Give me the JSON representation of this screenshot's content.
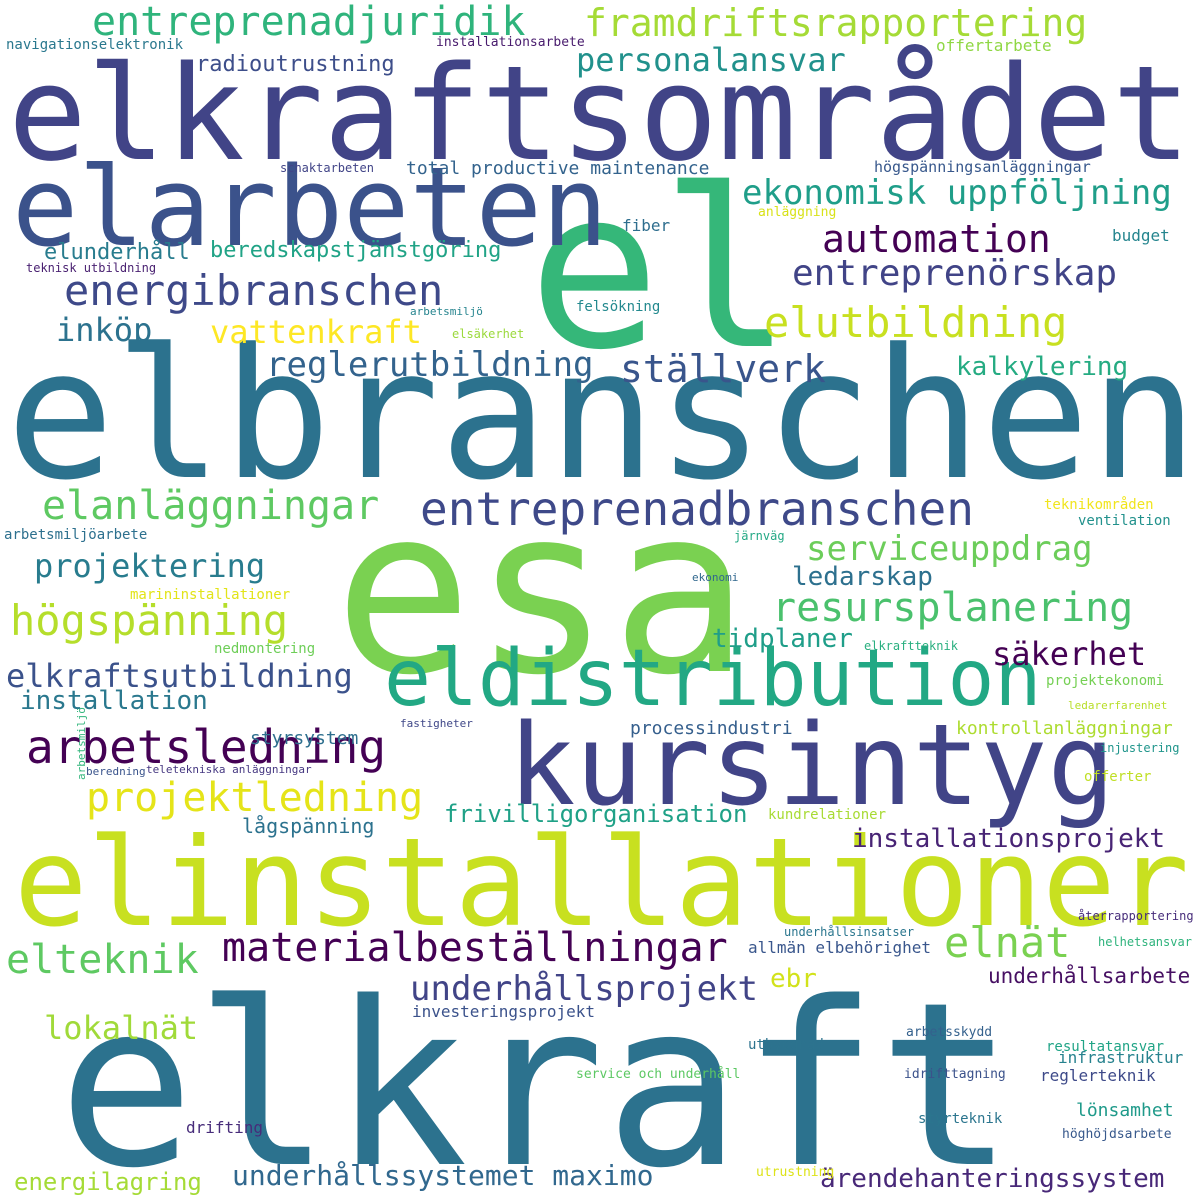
{
  "palette": [
    "#440154",
    "#46327e",
    "#365c8d",
    "#277f8e",
    "#1fa187",
    "#4ac16d",
    "#a0da39",
    "#fde725"
  ],
  "words": [
    {
      "id": "elkraft",
      "text": "elkraft",
      "color": "#2c728e"
    },
    {
      "id": "elbranschen",
      "text": "elbranschen",
      "color": "#2c728e"
    },
    {
      "id": "esa",
      "text": "esa",
      "color": "#7ad151"
    },
    {
      "id": "elkraftsomradet",
      "text": "elkraftsområdet",
      "color": "#414487"
    },
    {
      "id": "el",
      "text": "el",
      "color": "#35b779"
    },
    {
      "id": "elinstallationer",
      "text": "elinstallationer",
      "color": "#c8e020"
    },
    {
      "id": "elarbeten",
      "text": "elarbeten",
      "color": "#3b528b"
    },
    {
      "id": "kursintyg",
      "text": "kursintyg",
      "color": "#414487"
    },
    {
      "id": "eldistribution",
      "text": "eldistribution",
      "color": "#22a884"
    },
    {
      "id": "entreprenadjuridik",
      "text": "entreprenadjuridik",
      "color": "#2fb47c"
    },
    {
      "id": "framdriftsrapportering",
      "text": "framdriftsrapportering",
      "color": "#a5db36"
    },
    {
      "id": "entreprenadbranschen",
      "text": "entreprenadbranschen",
      "color": "#3e4989"
    },
    {
      "id": "arbetsledning",
      "text": "arbetsledning",
      "color": "#440154"
    },
    {
      "id": "materialbestallningar",
      "text": "materialbeställningar",
      "color": "#440154"
    },
    {
      "id": "energibranschen",
      "text": "energibranschen",
      "color": "#3e4989"
    },
    {
      "id": "elanlaggningar",
      "text": "elanläggningar",
      "color": "#5ec962"
    },
    {
      "id": "resursplanering",
      "text": "resursplanering",
      "color": "#4ac16d"
    },
    {
      "id": "hogspanning",
      "text": "högspänning",
      "color": "#b5de2b"
    },
    {
      "id": "elutbildning",
      "text": "elutbildning",
      "color": "#c8e020"
    },
    {
      "id": "projektledning",
      "text": "projektledning",
      "color": "#e5e419"
    },
    {
      "id": "entreprenorskap",
      "text": "entreprenörskap",
      "color": "#414487"
    },
    {
      "id": "automation",
      "text": "automation",
      "color": "#440154"
    },
    {
      "id": "ekonomisk-uppfoljning",
      "text": "ekonomisk uppföljning",
      "color": "#1f9e89"
    },
    {
      "id": "serviceuppdrag",
      "text": "serviceuppdrag",
      "color": "#6ccd5a"
    },
    {
      "id": "reglerutbildning",
      "text": "reglerutbildning",
      "color": "#33638d"
    },
    {
      "id": "stallverk",
      "text": "ställverk",
      "color": "#39558c"
    },
    {
      "id": "elkraftsutbildning",
      "text": "elkraftsutbildning",
      "color": "#3b528b"
    },
    {
      "id": "underhallsprojekt",
      "text": "underhållsprojekt",
      "color": "#414487"
    },
    {
      "id": "underhallssystemet-maximo",
      "text": "underhållssystemet maximo",
      "color": "#31688e"
    },
    {
      "id": "elnat",
      "text": "elnät",
      "color": "#7ad151"
    },
    {
      "id": "elteknik",
      "text": "elteknik",
      "color": "#5ec962"
    },
    {
      "id": "personalansvar",
      "text": "personalansvar",
      "color": "#21918c"
    },
    {
      "id": "projektering",
      "text": "projektering",
      "color": "#287c8e"
    },
    {
      "id": "vattenkraft",
      "text": "vattenkraft",
      "color": "#fde725"
    },
    {
      "id": "installationsprojekt",
      "text": "installationsprojekt",
      "color": "#482475"
    },
    {
      "id": "arendehanteringssystem",
      "text": "ärendehanteringssystem",
      "color": "#482878"
    },
    {
      "id": "lokalnat",
      "text": "lokalnät",
      "color": "#a0da39"
    },
    {
      "id": "inkop",
      "text": "inköp",
      "color": "#2c728e"
    },
    {
      "id": "sakerhet",
      "text": "säkerhet",
      "color": "#440154"
    },
    {
      "id": "underhallsarbete",
      "text": "underhållsarbete",
      "color": "#471063"
    },
    {
      "id": "frivilligorganisation",
      "text": "frivilligorganisation",
      "color": "#1fa187"
    },
    {
      "id": "installation",
      "text": "installation",
      "color": "#2a788e"
    },
    {
      "id": "ledarskap",
      "text": "ledarskap",
      "color": "#2d708e"
    },
    {
      "id": "kalkylering",
      "text": "kalkylering",
      "color": "#25ab82"
    },
    {
      "id": "tidplaner",
      "text": "tidplaner",
      "color": "#1f9e89"
    },
    {
      "id": "beredskapstjanstgoring",
      "text": "beredskapstjänstgöring",
      "color": "#20a386"
    },
    {
      "id": "elunderhall",
      "text": "elunderhåll",
      "color": "#287c8e"
    },
    {
      "id": "radioutrustning",
      "text": "radioutrustning",
      "color": "#3d4e8a"
    },
    {
      "id": "energilagring",
      "text": "energilagring",
      "color": "#a5db36"
    },
    {
      "id": "lonsamhet",
      "text": "lönsamhet",
      "color": "#1f9a8a"
    },
    {
      "id": "ebr",
      "text": "ebr",
      "color": "#d2e21b"
    },
    {
      "id": "styrsystem",
      "text": "styrsystem",
      "color": "#2e6f8e"
    },
    {
      "id": "lagspanning",
      "text": "lågspänning",
      "color": "#2c728e"
    },
    {
      "id": "total-productive-maintenance",
      "text": "total productive maintenance",
      "color": "#33638d"
    },
    {
      "id": "processindustri",
      "text": "processindustri",
      "color": "#355f8d"
    },
    {
      "id": "kontrollanlaggningar",
      "text": "kontrollanläggningar",
      "color": "#addc30"
    },
    {
      "id": "navigationselektronik",
      "text": "navigationselektronik",
      "color": "#2a788e"
    },
    {
      "id": "installationsarbete",
      "text": "installationsarbete",
      "color": "#481b6d"
    },
    {
      "id": "offertarbete",
      "text": "offertarbete",
      "color": "#8fd744"
    },
    {
      "id": "hogspanningsanlaggningar",
      "text": "högspänningsanläggningar",
      "color": "#38588c"
    },
    {
      "id": "schaktarbeten",
      "text": "schaktarbeten",
      "color": "#414487"
    },
    {
      "id": "anlaggning",
      "text": "anläggning",
      "color": "#d8e219"
    },
    {
      "id": "fiber",
      "text": "fiber",
      "color": "#2e6e8e"
    },
    {
      "id": "budget",
      "text": "budget",
      "color": "#25858e"
    },
    {
      "id": "teknisk-utbildning",
      "text": "teknisk utbildning",
      "color": "#481f70"
    },
    {
      "id": "arbetsmiljo",
      "text": "arbetsmiljö",
      "color": "#25848e"
    },
    {
      "id": "felsokning",
      "text": "felsökning",
      "color": "#23898e"
    },
    {
      "id": "elsakerhet",
      "text": "elsäkerhet",
      "color": "#9bd93c"
    },
    {
      "id": "teknikomraden",
      "text": "teknikområden",
      "color": "#f1e51d"
    },
    {
      "id": "ventilation",
      "text": "ventilation",
      "color": "#21918c"
    },
    {
      "id": "arbetsmiljoarbete",
      "text": "arbetsmiljöarbete",
      "color": "#2d708e"
    },
    {
      "id": "jarnvag",
      "text": "järnväg",
      "color": "#22a884"
    },
    {
      "id": "ekonomi",
      "text": "ekonomi",
      "color": "#31688e"
    },
    {
      "id": "marininstallationer",
      "text": "marininstallationer",
      "color": "#e2e418"
    },
    {
      "id": "nedmontering",
      "text": "nedmontering",
      "color": "#6ece58"
    },
    {
      "id": "elkraftteknik",
      "text": "elkraftteknik",
      "color": "#29af7f"
    },
    {
      "id": "projektekonomi",
      "text": "projektekonomi",
      "color": "#75d054"
    },
    {
      "id": "ledarerfarenhet",
      "text": "ledarerfarenhet",
      "color": "#b8de29"
    },
    {
      "id": "fastigheter",
      "text": "fastigheter",
      "color": "#3f4788"
    },
    {
      "id": "arbetsmiljo-v",
      "text": "arbetsmiljö",
      "color": "#31b57b"
    },
    {
      "id": "beredning",
      "text": "beredning",
      "color": "#3a548c"
    },
    {
      "id": "teletekniska-anlaggningar",
      "text": "teletekniska anläggningar",
      "color": "#453781"
    },
    {
      "id": "injustering",
      "text": "injustering",
      "color": "#1f958b"
    },
    {
      "id": "offerter",
      "text": "offerter",
      "color": "#c0df25"
    },
    {
      "id": "kundrelationer",
      "text": "kundrelationer",
      "color": "#a8db34"
    },
    {
      "id": "aterrapportering",
      "text": "återrapportering",
      "color": "#472d7b"
    },
    {
      "id": "helhetsansvar",
      "text": "helhetsansvar",
      "color": "#2eb37c"
    },
    {
      "id": "underhallsinsatser",
      "text": "underhållsinsatser",
      "color": "#2a768e"
    },
    {
      "id": "allman-elbehorighet",
      "text": "allmän elbehörighet",
      "color": "#39568c"
    },
    {
      "id": "investeringsprojekt",
      "text": "investeringsprojekt",
      "color": "#3b528b"
    },
    {
      "id": "utbyggnad",
      "text": "utbyggnad",
      "color": "#2c738e"
    },
    {
      "id": "arbetsskydd",
      "text": "arbetsskydd",
      "color": "#34618d"
    },
    {
      "id": "resultatansvar",
      "text": "resultatansvar",
      "color": "#20a486"
    },
    {
      "id": "infrastruktur",
      "text": "infrastruktur",
      "color": "#26828e"
    },
    {
      "id": "service-och-underhall",
      "text": "service och underhåll",
      "color": "#5cc863"
    },
    {
      "id": "idrifttagning",
      "text": "idrifttagning",
      "color": "#3b528b"
    },
    {
      "id": "reglerteknik",
      "text": "reglerteknik",
      "color": "#3e4a89"
    },
    {
      "id": "styrteknik",
      "text": "styrteknik",
      "color": "#2b758e"
    },
    {
      "id": "hoghojdsarbete",
      "text": "höghöjdsarbete",
      "color": "#38598c"
    },
    {
      "id": "drifting",
      "text": "drifting",
      "color": "#472c7a"
    },
    {
      "id": "utrustning",
      "text": "utrustning",
      "color": "#dde318"
    }
  ]
}
